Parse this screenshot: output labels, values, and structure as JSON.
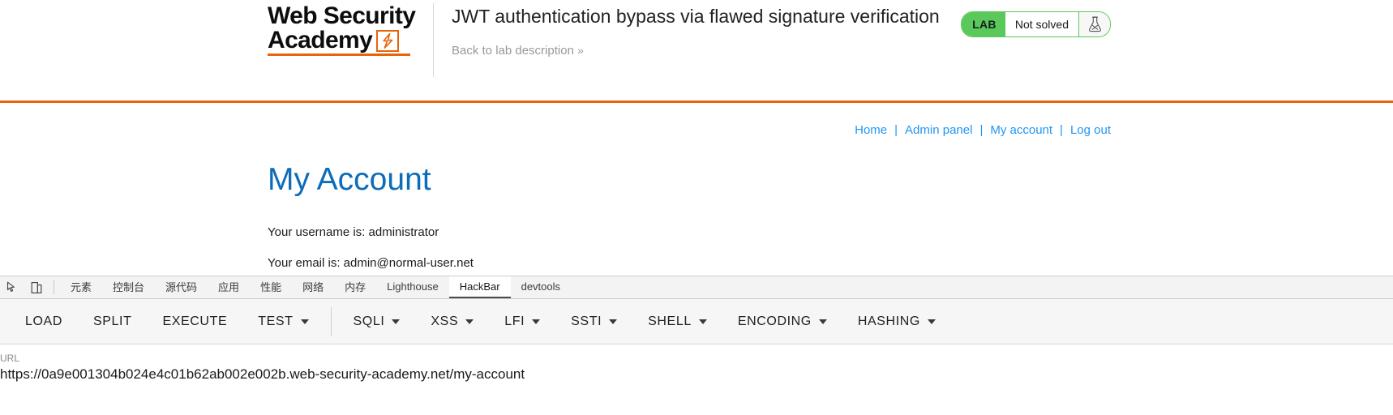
{
  "header": {
    "logo_line1": "Web Security",
    "logo_line2": "Academy",
    "logo_mark_icon": "lightning-bolt-icon",
    "lab_title": "JWT authentication bypass via flawed signature verification",
    "back_link": "Back to lab description",
    "back_chevrons": "»",
    "lab_tag": "LAB",
    "lab_state": "Not solved",
    "flask_icon": "flask-icon",
    "accent_color": "#e8630a",
    "status_color": "#5ac85a"
  },
  "nav": {
    "separator": "|",
    "items": [
      {
        "label": "Home"
      },
      {
        "label": "Admin panel"
      },
      {
        "label": "My account"
      },
      {
        "label": "Log out"
      }
    ]
  },
  "account": {
    "title": "My Account",
    "username_line": "Your username is: administrator",
    "email_line": "Your email is: admin@normal-user.net"
  },
  "devtools": {
    "inspect_icon": "inspect-element-icon",
    "device_icon": "device-toolbar-icon",
    "tabs": [
      {
        "label": "元素",
        "active": false
      },
      {
        "label": "控制台",
        "active": false
      },
      {
        "label": "源代码",
        "active": false
      },
      {
        "label": "应用",
        "active": false
      },
      {
        "label": "性能",
        "active": false
      },
      {
        "label": "网络",
        "active": false
      },
      {
        "label": "内存",
        "active": false
      },
      {
        "label": "Lighthouse",
        "active": false
      },
      {
        "label": "HackBar",
        "active": true
      },
      {
        "label": "devtools",
        "active": false
      }
    ]
  },
  "hackbar": {
    "buttons": [
      {
        "label": "LOAD",
        "dropdown": false
      },
      {
        "label": "SPLIT",
        "dropdown": false
      },
      {
        "label": "EXECUTE",
        "dropdown": false
      },
      {
        "label": "TEST",
        "dropdown": true
      }
    ],
    "menus": [
      {
        "label": "SQLI",
        "dropdown": true
      },
      {
        "label": "XSS",
        "dropdown": true
      },
      {
        "label": "LFI",
        "dropdown": true
      },
      {
        "label": "SSTI",
        "dropdown": true
      },
      {
        "label": "SHELL",
        "dropdown": true
      },
      {
        "label": "ENCODING",
        "dropdown": true
      },
      {
        "label": "HASHING",
        "dropdown": true
      }
    ],
    "url_label": "URL",
    "url_value": "https://0a9e001304b024e4c01b62ab002e002b.web-security-academy.net/my-account"
  }
}
